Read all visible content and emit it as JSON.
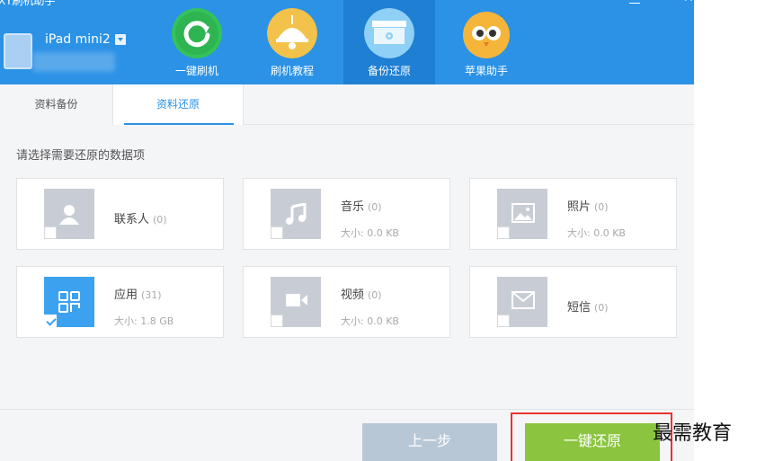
{
  "window": {
    "title": "XY刷机助手"
  },
  "device": {
    "name": "iPad mini2"
  },
  "nav": [
    {
      "label": "一键刷机",
      "icon": "refresh-icon",
      "color": "#34c25a"
    },
    {
      "label": "刷机教程",
      "icon": "lamp-icon",
      "color": "#f3c24a"
    },
    {
      "label": "备份还原",
      "icon": "backup-disk-icon",
      "color": "#8fd0f7"
    },
    {
      "label": "苹果助手",
      "icon": "owl-icon",
      "color": "#f4b53a"
    }
  ],
  "tabs": {
    "backup": "资料备份",
    "restore": "资料还原"
  },
  "prompt": "请选择需要还原的数据项",
  "items": {
    "contacts": {
      "name": "联系人",
      "count": "(0)"
    },
    "music": {
      "name": "音乐",
      "count": "(0)",
      "size": "大小: 0.0 KB"
    },
    "photos": {
      "name": "照片",
      "count": "(0)",
      "size": "大小: 0.0 KB"
    },
    "apps": {
      "name": "应用",
      "count": "(31)",
      "size": "大小: 1.8 GB",
      "checked": true
    },
    "videos": {
      "name": "视频",
      "count": "(0)",
      "size": "大小: 0.0 KB"
    },
    "sms": {
      "name": "短信",
      "count": "(0)"
    }
  },
  "buttons": {
    "prev": "上一步",
    "restore": "一键还原"
  },
  "watermark": "最需教育",
  "colors": {
    "header": "#2b92e6",
    "accent": "#3ca2f0",
    "restore_button": "#8bc53f",
    "highlight": "#e8352e"
  }
}
